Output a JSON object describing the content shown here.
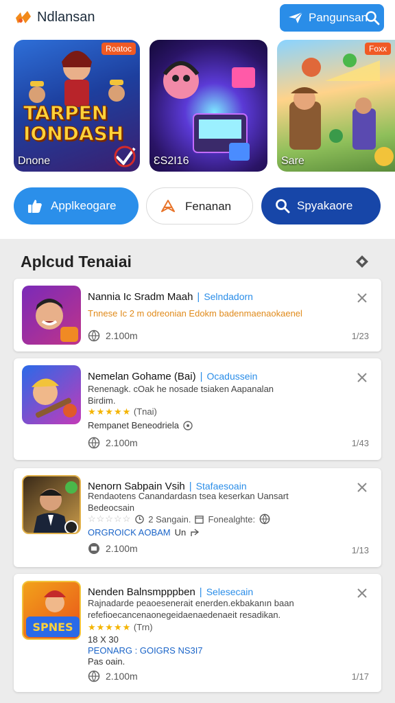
{
  "header": {
    "app_title": "Ndlansan",
    "action_label": "Pangunsan"
  },
  "banners": [
    {
      "art_text_1": "TARPEN",
      "art_text_2": "IONDASH",
      "caption": "Dnone",
      "tag": "Roatoc"
    },
    {
      "art_text_1": "",
      "art_text_2": "",
      "caption": "ƐS2I16",
      "tag": ""
    },
    {
      "art_text_1": "",
      "art_text_2": "",
      "caption": "Sare",
      "tag": "Foxx"
    }
  ],
  "pills": [
    {
      "label": "Applkeogare",
      "icon": "thumbs-up-icon"
    },
    {
      "label": "Fenanan",
      "icon": "bookmark-icon"
    },
    {
      "label": "Spyakaore",
      "icon": "search-icon"
    }
  ],
  "section": {
    "title": "Aplcud Tenaiai"
  },
  "apps": [
    {
      "name": "Nannia Ic Sradm Maah",
      "category": "Selndadorn",
      "desc_1": "Tnnese Ic 2 m odreonian Edokm badenmaenaokaenel",
      "downloads": "2.100m",
      "count": "1/23"
    },
    {
      "name": "Nemelan Gohame (Bai)",
      "category": "Ocadussein",
      "desc_1": "Renenagk. cOak  he nosade tsiaken Aapanalan",
      "desc_2": "Birdim.",
      "rating_text": "(Tnai)",
      "meta": "Rempanet Beneodriela",
      "downloads": "2.100m",
      "count": "1/43"
    },
    {
      "name": "Nenorn Sabpain Vsih",
      "category": "Stafaesoain",
      "desc_1": "Rendaotens Canandardasn tsea keserkan Uansart",
      "desc_2": "Bedeocsain",
      "rating_text": "2 Sangain.",
      "meta_extra": "Fonealghte:",
      "meta": "ORGROICK AOBAM",
      "meta_2": "Un",
      "downloads": "2.100m",
      "count": "1/13"
    },
    {
      "name": "Nenden Balnsmpppben",
      "category": "Selesecain",
      "desc_1": "Rajnadarde peaoesenerait enerden.ekbakanın baan",
      "desc_2": "refefioecancenaonegeidaenaedenaeit resadikan.",
      "rating_text": "(Trn)",
      "meta_top": "18 X 30",
      "meta": "PEONARG : GOIGRS NS3I7",
      "meta_2": "Pas oain.",
      "downloads": "2.100m",
      "count": "1/17"
    }
  ]
}
